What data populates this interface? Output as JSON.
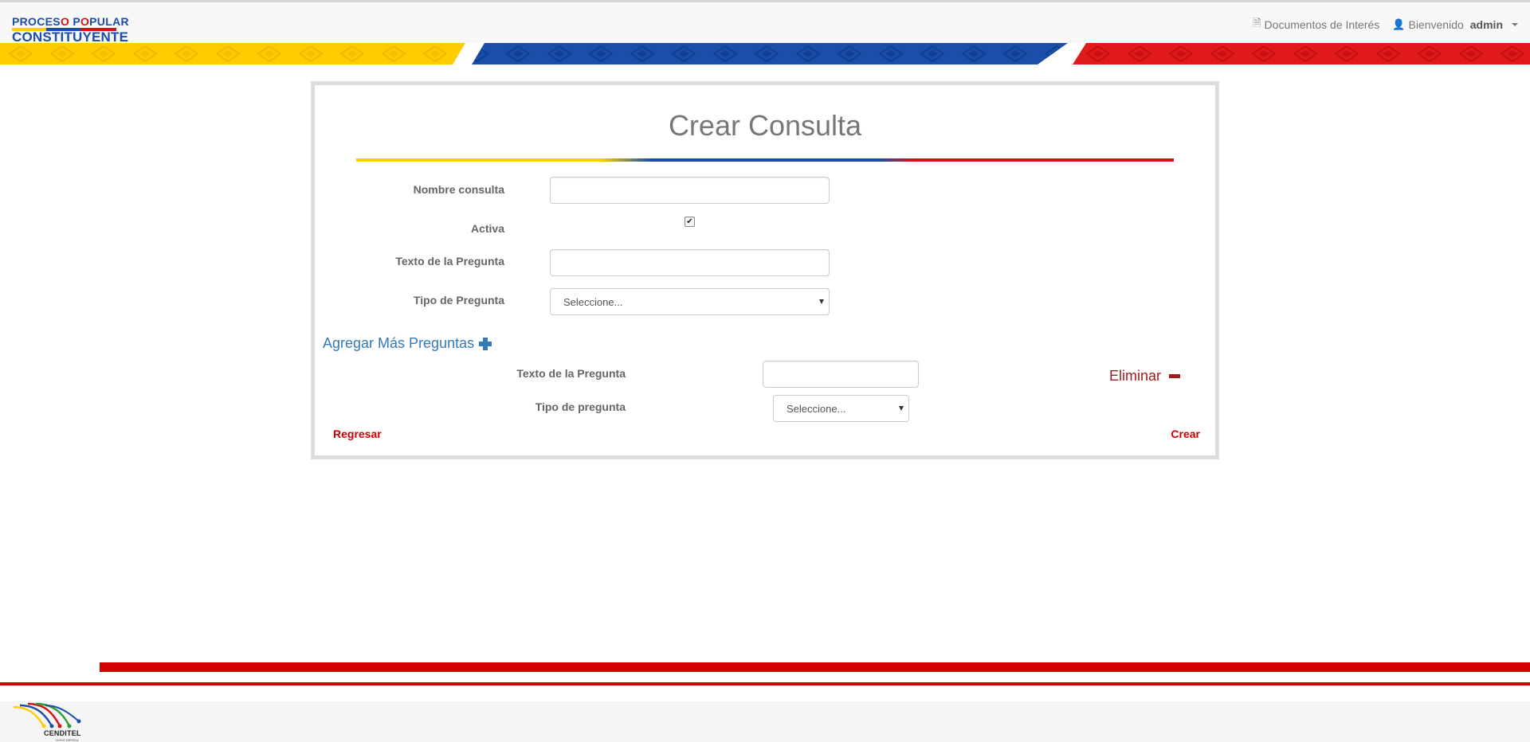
{
  "header": {
    "brand_line1_a": "PROCES",
    "brand_line1_o": "O",
    "brand_line1_b": " P",
    "brand_line1_c": "O",
    "brand_line1_d": "PULAR",
    "brand_line2": "CONSTITUYENTE",
    "documents_link": "Documentos de Interés",
    "welcome_text": "Bienvenido",
    "username": "admin"
  },
  "form": {
    "title": "Crear Consulta",
    "fields": {
      "nombre_label": "Nombre consulta",
      "nombre_value": "",
      "activa_label": "Activa",
      "activa_checked": true,
      "texto_label": "Texto de la Pregunta",
      "texto_value": "",
      "tipo_label": "Tipo de Pregunta",
      "tipo_selected": "Seleccione..."
    },
    "add_more_label": "Agregar Más Preguntas",
    "extra_question": {
      "texto_label": "Texto de la Pregunta",
      "texto_value": "",
      "tipo_label": "Tipo de pregunta",
      "tipo_selected": "Seleccione...",
      "delete_label": "Eliminar"
    },
    "back_label": "Regresar",
    "create_label": "Crear"
  },
  "footer": {
    "logo_text": "CENDITEL",
    "logo_subtext": "NODO MÉRIDA"
  },
  "colors": {
    "yellow": "#ffcc00",
    "blue": "#1a4ea8",
    "red": "#d41414",
    "link_blue": "#337ab7",
    "danger_red": "#cc0000"
  }
}
